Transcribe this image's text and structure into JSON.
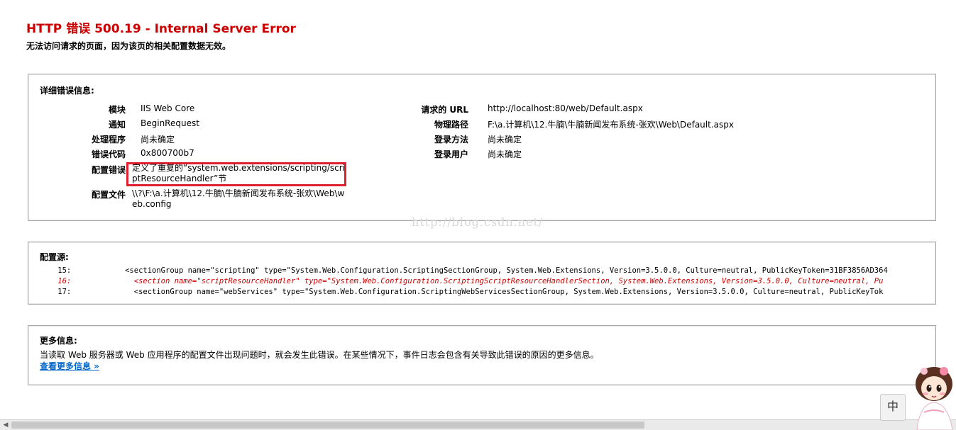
{
  "header": {
    "title": "HTTP 错误 500.19 - Internal Server Error",
    "subtitle": "无法访问请求的页面，因为该页的相关配置数据无效。"
  },
  "details": {
    "heading": "详细错误信息:",
    "left": [
      {
        "label": "模块",
        "value": "IIS Web Core"
      },
      {
        "label": "通知",
        "value": "BeginRequest"
      },
      {
        "label": "处理程序",
        "value": "尚未确定"
      },
      {
        "label": "错误代码",
        "value": "0x800700b7"
      }
    ],
    "config_error": {
      "label": "配置错误",
      "value": "定义了重复的“system.web.extensions/scripting/scriptResourceHandler”节"
    },
    "config_file": {
      "label": "配置文件",
      "value": "\\\\?\\F:\\a.计算机\\12.牛腩\\牛腩新闻发布系统-张欢\\Web\\web.config"
    },
    "right": [
      {
        "label": "请求的 URL",
        "value": "http://localhost:80/web/Default.aspx"
      },
      {
        "label": "物理路径",
        "value": "F:\\a.计算机\\12.牛腩\\牛腩新闻发布系统-张欢\\Web\\Default.aspx"
      },
      {
        "label": "登录方法",
        "value": "尚未确定"
      },
      {
        "label": "登录用户",
        "value": "尚未确定"
      }
    ]
  },
  "watermark": "http://blog.csdn.net/",
  "source": {
    "heading": "配置源:",
    "lines": [
      "    15:            <sectionGroup name=\"scripting\" type=\"System.Web.Configuration.ScriptingSectionGroup, System.Web.Extensions, Version=3.5.0.0, Culture=neutral, PublicKeyToken=31BF3856AD364",
      "    16:              <section name=\"scriptResourceHandler\" type=\"System.Web.Configuration.ScriptingScriptResourceHandlerSection, System.Web.Extensions, Version=3.5.0.0, Culture=neutral, Pu",
      "    17:              <sectionGroup name=\"webServices\" type=\"System.Web.Configuration.ScriptingWebServicesSectionGroup, System.Web.Extensions, Version=3.5.0.0, Culture=neutral, PublicKeyTok"
    ]
  },
  "more_info": {
    "heading": "更多信息:",
    "text": "当读取 Web 服务器或 Web 应用程序的配置文件出现问题时，就会发生此错误。在某些情况下，事件日志会包含有关导致此错误的原因的更多信息。",
    "link": "查看更多信息 »"
  },
  "widget": {
    "glyph": "中",
    "icon": "mascot-girl-icon"
  },
  "colors": {
    "title": "#cc0000",
    "highlight_box": "#e0202e",
    "link": "#0066cc"
  }
}
